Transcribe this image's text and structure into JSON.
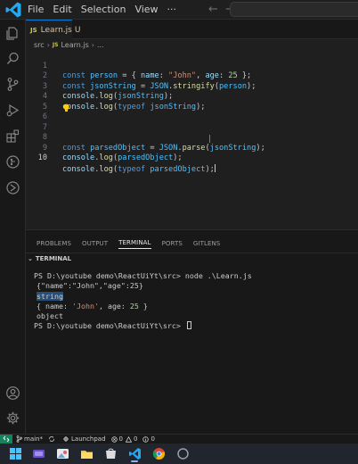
{
  "menu": {
    "file": "File",
    "edit": "Edit",
    "selection": "Selection",
    "view": "View"
  },
  "tab": {
    "badge": "JS",
    "name": "Learn.js",
    "status": "U"
  },
  "breadcrumb": {
    "folder": "src",
    "badge": "JS",
    "file": "Learn.js",
    "more": "..."
  },
  "editor": {
    "line_numbers": [
      "1",
      "2",
      "3",
      "4",
      "5",
      "6",
      "7",
      "8",
      "9",
      "10"
    ]
  },
  "panel": {
    "tabs": [
      "PROBLEMS",
      "OUTPUT",
      "TERMINAL",
      "PORTS",
      "GITLENS"
    ],
    "active_tab": "TERMINAL",
    "section_title": "TERMINAL"
  },
  "terminal": {
    "line1": "PS D:\\youtube demo\\ReactUiYt\\src> node .\\Learn.js",
    "line2": "{\"name\":\"John\",\"age\":25}",
    "line3": "string",
    "line4_a": "{ name: ",
    "line4_str": "'John'",
    "line4_b": ", age: ",
    "line4_num": "25",
    "line4_c": " }",
    "line5": "object",
    "line6": "PS D:\\youtube demo\\ReactUiYt\\src> "
  },
  "statusbar": {
    "branch": "main*",
    "launchpad": "Launchpad",
    "errors": "0",
    "warnings": "0",
    "infos": "0"
  },
  "colors": {
    "accent": "#0078d4",
    "remote": "#16825d",
    "js_badge": "#cbcb41",
    "modified": "#e2c08d"
  }
}
